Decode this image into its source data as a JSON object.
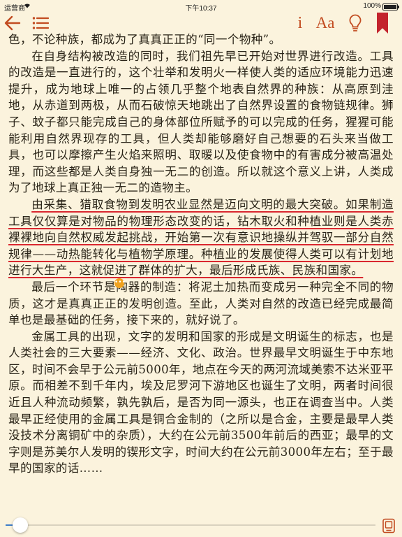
{
  "status": {
    "carrier": "运营商",
    "time": "下午10:37",
    "battery_text": "100%",
    "battery_level": 1.0
  },
  "toolbar": {
    "info_label": "i",
    "font_label": "Aa"
  },
  "colors": {
    "accent": "#c24c21",
    "bookmark": "#c3232d",
    "highlight": "#d9272f",
    "background": "#fbf3dd",
    "slider": "#3d7cc9"
  },
  "content": {
    "p1": "色，不论种族，都成为了真真正正的“同一个物种”。",
    "p2": "在自身结构被改造的同时，我们祖先早已开始对世界进行改造。工具的改造是一直进行的，这个壮举和发明火一样使人类的适应环境能力迅速提升，成为地球上唯一的占领几乎整个地表自然界的种族：从高原到洼地，从赤道到两极，从而石破惊天地跳出了自然界设置的食物链规律。狮子、蚊子都只能完成自己的身体部位所赋予的可以完成的任务，猩猩可能能利用自然界现存的工具，但人类却能够磨好自己想要的石头来当做工具，也可以摩擦产生火焰来照明、取暖以及使食物中的有害成分被高温处理，而这些都是人类自身独一无二的创造。所以就这个意义上讲，人类成为了地球上真正独一无二的造物主。",
    "p3": "由采集、猎取食物到发明农业显然是迈向文明的最大突破。如果制造工具仅仅算是对物品的物理形态改变的话，钻木取火和种植业则是人类赤裸裸地向自然权威发起挑战，开始第一次有意识地操纵并驾驭一部分自然规律——动热能转化与植物学原理。种植业的发展使得人类可以有计划地进行大生产，这就促进了群体的扩大，最后形成氏族、民族和国家。",
    "p4": "最后一个环节是陶器的制造：将泥土加热而变成另一种完全不同的物质，这才是真真正正的发明创造。至此，人类对自然的改造已经完成最简单也是最基础的任务，接下来的，就好说了。",
    "p5": "金属工具的出现，文字的发明和国家的形成是文明诞生的标志，也是人类社会的三大要素——经济、文化、政治。世界最早文明诞生于中东地区，时间不会早于公元前5000年，地点在今天的两河流域美索不达米亚平原。而相差不到千年内，埃及尼罗河下游地区也诞生了文明，两者时间很近且人种流动频繁，孰先孰后，是否为同一源头，也正在调查当中。人类最早正经使用的金属工具是铜合金制的（之所以是合金，主要是最早人类没技术分离铜矿中的杂质），大约在公元前3500年前后的西亚；最早的文字则是苏美尔人发明的锲形文字，时间大约在公元前3000年左右；至于最早的国家的话……"
  },
  "reader": {
    "progress": 0.04
  }
}
